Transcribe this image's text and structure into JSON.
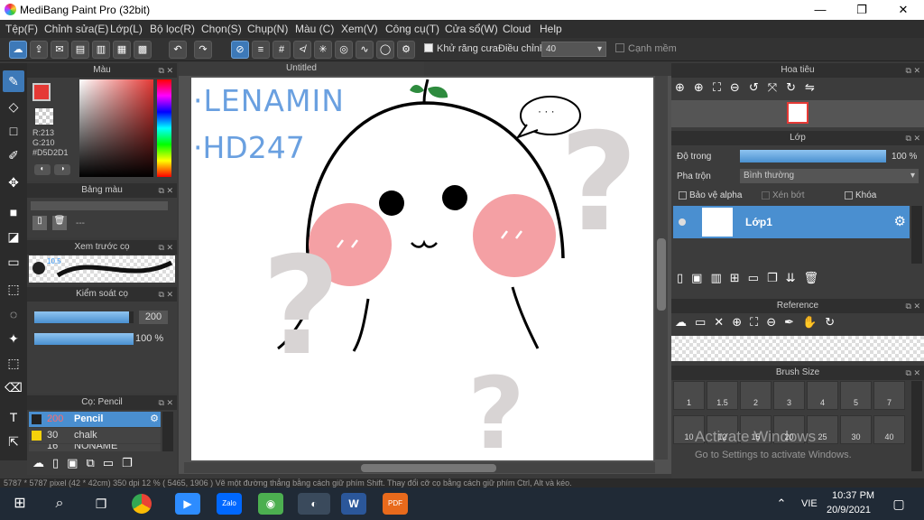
{
  "window": {
    "title": "MediBang Paint Pro (32bit)",
    "minimize": "—",
    "maximize": "❐",
    "close": "✕"
  },
  "menu": [
    "Tệp(F)",
    "Chỉnh sửa(E)",
    "Lớp(L)",
    "Bộ lọc(R)",
    "Chọn(S)",
    "Chụp(N)",
    "Màu (C)",
    "Xem(V)",
    "Công cụ(T)",
    "Cửa sổ(W)",
    "Cloud",
    "Help"
  ],
  "toolbar": {
    "antialias_label": "Khử răng cưa",
    "adjust_label": "Điều chỉnh",
    "adjust_value": "40",
    "smooth_label": "Cạnh mềm"
  },
  "color_panel": {
    "title": "Màu",
    "r": "R:213",
    "g": "G:210",
    "hex": "#D5D2D1"
  },
  "palette_panel": {
    "title": "Bảng màu",
    "empty": "---"
  },
  "brush_preview": {
    "title": "Xem trước cọ",
    "size": "10.5"
  },
  "brush_control": {
    "title": "Kiểm soát cọ",
    "size": "200",
    "opacity": "100 %",
    "size_fill": 0.95,
    "opacity_fill": 1.0
  },
  "brush_list": {
    "title": "Cọ: Pencil",
    "items": [
      {
        "size": "200",
        "name": "Pencil"
      },
      {
        "size": "30",
        "name": "chalk"
      },
      {
        "size": "16",
        "name": "NONAME"
      }
    ]
  },
  "document": {
    "tab": "Untitled"
  },
  "canvas": {
    "text1": "·LENAMIN",
    "text2": "·HD247",
    "bubble": "· · ·"
  },
  "navigator": {
    "title": "Hoa tiêu"
  },
  "layer_panel": {
    "title": "Lớp",
    "opacity_label": "Độ trong",
    "opacity_value": "100 %",
    "blend_label": "Pha trộn",
    "blend_value": "Bình thường",
    "protect_alpha": "Bảo vệ alpha",
    "clipping": "Xén bớt",
    "lock": "Khóa",
    "layer_name": "Lớp1"
  },
  "reference": {
    "title": "Reference"
  },
  "brush_size": {
    "title": "Brush Size",
    "row1": [
      "1",
      "1.5",
      "2",
      "3",
      "4",
      "5",
      "7"
    ],
    "row2": [
      "10",
      "12",
      "15",
      "20",
      "25",
      "30",
      "40"
    ]
  },
  "watermark": {
    "line1": "Activate Windows",
    "line2": "Go to Settings to activate Windows."
  },
  "status": {
    "text": "5787 * 5787 pixel   (42 * 42cm)   350 dpi   12 %   ( 5465, 1906 )   Vẽ một đường thẳng bằng cách giữ phím Shift. Thay đổi cỡ cọ bằng cách giữ phím Ctrl, Alt và kéo."
  },
  "taskbar": {
    "lang": "VIE",
    "time": "10:37 PM",
    "date": "20/9/2021"
  },
  "colors": {
    "accent": "#3d79b8",
    "red": "#e53935",
    "green": "#2e9e2e"
  }
}
